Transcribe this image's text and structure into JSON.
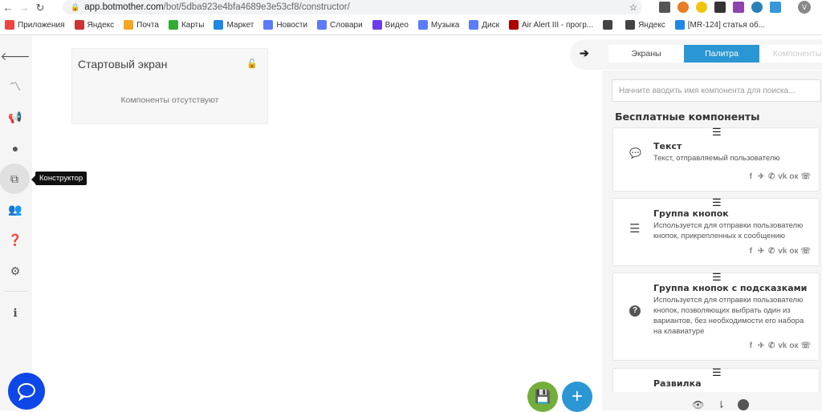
{
  "browser": {
    "url_host": "app.botmother.com",
    "url_path": "/bot/5dba923e4bfa4689e3e53cf8/constructor/",
    "avatar_letter": "V",
    "bookmarks": [
      {
        "label": "Приложения",
        "color": "#e44"
      },
      {
        "label": "Яндекс",
        "color": "#c33"
      },
      {
        "label": "Почта",
        "color": "#f5a623"
      },
      {
        "label": "Карты",
        "color": "#3a3"
      },
      {
        "label": "Маркет",
        "color": "#1e88e5"
      },
      {
        "label": "Новости",
        "color": "#5c7cfa"
      },
      {
        "label": "Словари",
        "color": "#5c7cfa"
      },
      {
        "label": "Видео",
        "color": "#6a3dea"
      },
      {
        "label": "Музыка",
        "color": "#5c7cfa"
      },
      {
        "label": "Диск",
        "color": "#5c7cfa"
      },
      {
        "label": "Air Alert III - прогр...",
        "color": "#a00"
      },
      {
        "label": "",
        "color": "#444"
      },
      {
        "label": "Яндекс",
        "color": "#444"
      },
      {
        "label": "[MR-124] статья об...",
        "color": "#1e88e5"
      }
    ]
  },
  "sidebar": {
    "items": [
      {
        "name": "back",
        "glyph": "🡐"
      },
      {
        "name": "analytics",
        "glyph": "📈"
      },
      {
        "name": "broadcast",
        "glyph": "📢"
      },
      {
        "name": "chats",
        "glyph": "💬"
      },
      {
        "name": "constructor",
        "glyph": "⧉"
      },
      {
        "name": "users",
        "glyph": "👥"
      },
      {
        "name": "help",
        "glyph": "?"
      },
      {
        "name": "settings",
        "glyph": "⚙"
      },
      {
        "name": "info",
        "glyph": "i"
      }
    ],
    "tooltip": "Конструктор"
  },
  "canvas": {
    "screen_card": {
      "title": "Стартовый экран",
      "empty_text": "Компоненты отсутствуют"
    }
  },
  "panel": {
    "tabs": [
      {
        "label": "Экраны"
      },
      {
        "label": "Палитра"
      },
      {
        "label": "Компоненты"
      }
    ],
    "search_placeholder": "Начните вводить имя компонента для поиска...",
    "section_title": "Бесплатные компоненты",
    "components": [
      {
        "title": "Текст",
        "description": "Текст, отправляемый пользователю",
        "icon": "💬"
      },
      {
        "title": "Группа кнопок",
        "description": "Используется для отправки пользователю кнопок, прикрепленных к сообщению",
        "icon": "☰"
      },
      {
        "title": "Группа кнопок с подсказками",
        "description": "Используется для отправки пользователю кнопок, позволяющих выбрать один из вариантов, без необходимости его набора на клавиатуре",
        "icon": "?"
      },
      {
        "title": "Развилка",
        "description": "",
        "icon": ""
      }
    ],
    "social": [
      "f",
      "✈",
      "✆",
      "vk",
      "ок",
      "☏"
    ]
  }
}
